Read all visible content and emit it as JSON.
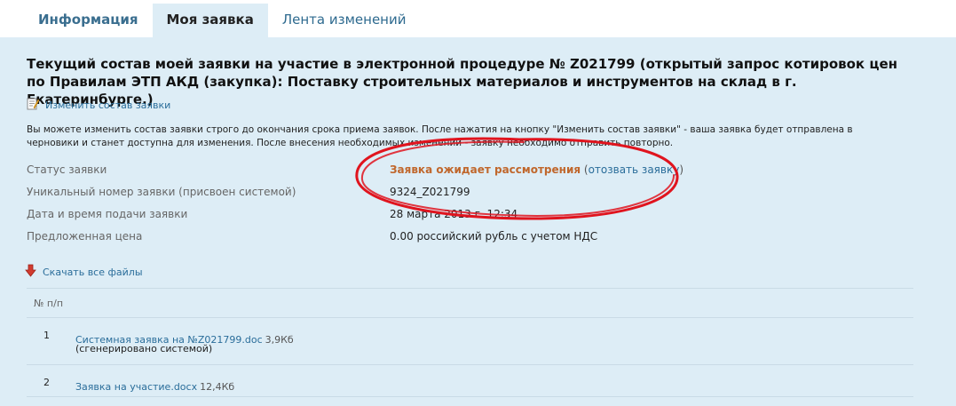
{
  "tabs": [
    {
      "label": "Информация"
    },
    {
      "label": "Моя заявка"
    },
    {
      "label": "Лента изменений"
    }
  ],
  "title": "Текущий состав моей заявки на участие в электронной процедуре № Z021799 (открытый запрос котировок цен по Правилам ЭТП АКД (закупка): Поставку строительных материалов и инструментов на склад в г. Екатеринбурге.)",
  "edit_link": {
    "label": "Изменить состав заявки",
    "icon": "edit-document-icon"
  },
  "info_text": "Вы можете изменить состав заявки строго до окончания срока приема заявок. После нажатия на кнопку \"Изменить состав заявки\" - ваша заявка будет отправлена в черновики и станет доступна для изменения. После внесения необходимых изменений - заявку необходимо отправить повторно.",
  "fields": {
    "status": {
      "label": "Статус заявки",
      "value": "Заявка ожидает рассмотрения",
      "open_paren": "(",
      "action": "отозвать заявку",
      "close_paren": ")"
    },
    "number": {
      "label": "Уникальный номер заявки (присвоен системой)",
      "value": "9324_Z021799"
    },
    "date": {
      "label": "Дата и время подачи заявки",
      "value": "28 марта 2013 г. 12:34"
    },
    "price": {
      "label": "Предложенная цена",
      "value": "0.00 российский рубль с учетом НДС"
    }
  },
  "download_link": {
    "label": "Скачать все файлы",
    "icon": "download-arrow-icon"
  },
  "files_table": {
    "column_header": "№ п/п",
    "rows": [
      {
        "num": "1",
        "name": "Системная заявка на №Z021799.doc",
        "size": "3,9Кб",
        "note": "(сгенерировано системой)"
      },
      {
        "num": "2",
        "name": "Заявка на участие.docx",
        "size": "12,4Кб"
      }
    ]
  },
  "colors": {
    "panel_bg": "#ddedf6",
    "link": "#2a6d9a",
    "status": "#c0672c",
    "annotation": "#e0141e"
  }
}
